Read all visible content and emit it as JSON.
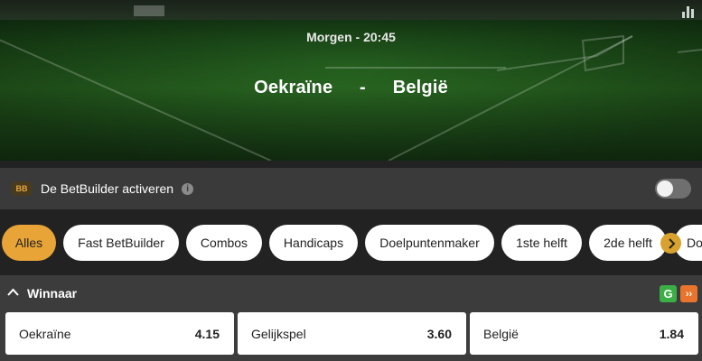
{
  "match": {
    "time": "Morgen - 20:45",
    "home": "Oekraïne",
    "separator": "-",
    "away": "België"
  },
  "betbuilder": {
    "badge": "BB",
    "label": "De BetBuilder activeren",
    "info": "i",
    "enabled": false
  },
  "filters": [
    {
      "label": "Alles",
      "active": true
    },
    {
      "label": "Fast BetBuilder",
      "active": false
    },
    {
      "label": "Combos",
      "active": false
    },
    {
      "label": "Handicaps",
      "active": false
    },
    {
      "label": "Doelpuntenmaker",
      "active": false
    },
    {
      "label": "1ste helft",
      "active": false
    },
    {
      "label": "2de helft",
      "active": false
    },
    {
      "label": "Do",
      "active": false
    }
  ],
  "market": {
    "title": "Winnaar",
    "icon_g": "G",
    "icon_ff": "››",
    "outcomes": [
      {
        "label": "Oekraïne",
        "odds": "4.15"
      },
      {
        "label": "Gelijkspel",
        "odds": "3.60"
      },
      {
        "label": "België",
        "odds": "1.84"
      }
    ]
  },
  "colors": {
    "accent": "#e8a436",
    "green_icon": "#3cae46",
    "orange_icon": "#e8742d"
  },
  "icons": [
    "stats-icon",
    "info-icon",
    "chevron-right-icon",
    "chevron-up-icon",
    "cash-out-icon",
    "fast-forward-icon"
  ]
}
